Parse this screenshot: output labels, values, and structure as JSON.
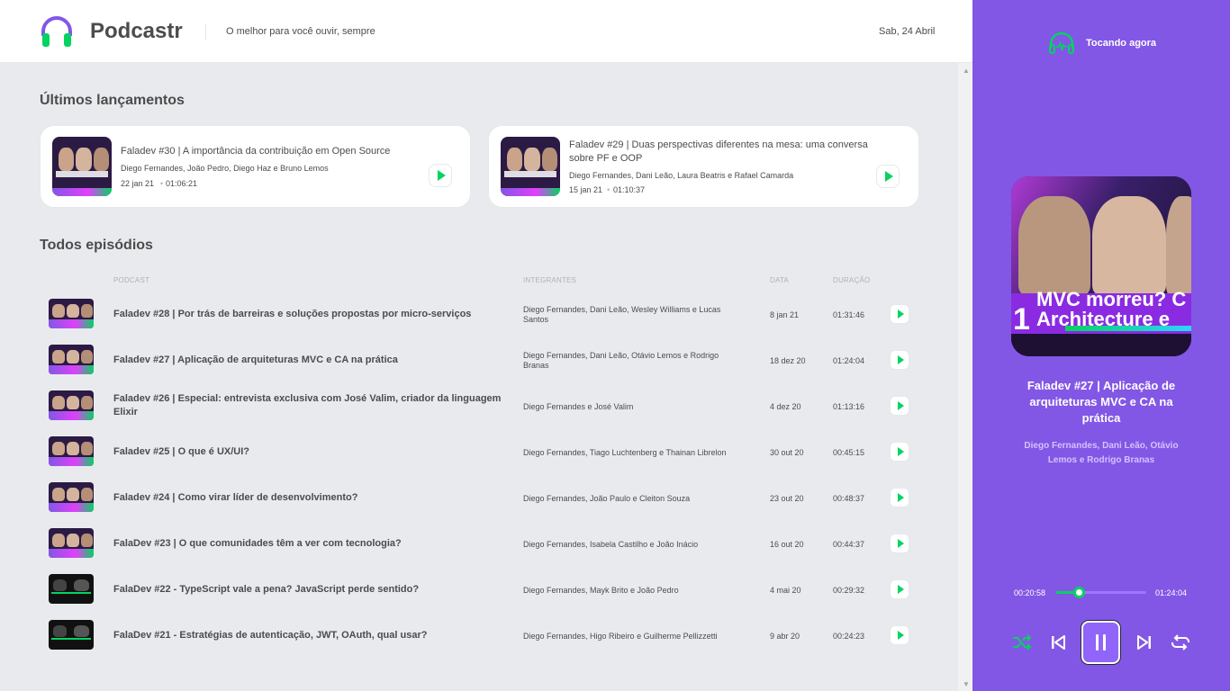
{
  "header": {
    "brand": "Podcastr",
    "tagline": "O melhor para você ouvir, sempre",
    "date": "Sab, 24 Abril"
  },
  "latest": {
    "title": "Últimos lançamentos",
    "episodes": [
      {
        "title": "Faladev #30 | A importância da contribuição em Open Source",
        "members": "Diego Fernandes, João Pedro, Diego Haz e Bruno Lemos",
        "date": "22 jan 21",
        "duration": "01:06:21"
      },
      {
        "title": "Faladev #29 | Duas perspectivas diferentes na mesa: uma conversa sobre PF e OOP",
        "members": "Diego Fernandes, Dani Leão, Laura Beatris e Rafael Camarda",
        "date": "15 jan 21",
        "duration": "01:10:37"
      }
    ]
  },
  "all": {
    "title": "Todos episódios",
    "columns": {
      "podcast": "PODCAST",
      "members": "INTEGRANTES",
      "date": "DATA",
      "duration": "DURAÇÃO"
    },
    "episodes": [
      {
        "title": "Faladev #28 | Por trás de barreiras e soluções propostas por micro-serviços",
        "members": "Diego Fernandes, Dani Leão, Wesley Williams e Lucas Santos",
        "date": "8 jan 21",
        "duration": "01:31:46"
      },
      {
        "title": "Faladev #27 | Aplicação de arquiteturas MVC e CA na prática",
        "members": "Diego Fernandes, Dani Leão, Otávio Lemos e Rodrigo Branas",
        "date": "18 dez 20",
        "duration": "01:24:04"
      },
      {
        "title": "Faladev #26 | Especial: entrevista exclusiva com José Valim, criador da linguagem Elixir",
        "members": "Diego Fernandes e José Valim",
        "date": "4 dez 20",
        "duration": "01:13:16"
      },
      {
        "title": "Faladev #25 | O que é UX/UI?",
        "members": "Diego Fernandes, Tiago Luchtenberg e Thainan Librelon",
        "date": "30 out 20",
        "duration": "00:45:15"
      },
      {
        "title": "Faladev #24 | Como virar líder de desenvolvimento?",
        "members": "Diego Fernandes, João Paulo e Cleiton Souza",
        "date": "23 out 20",
        "duration": "00:48:37"
      },
      {
        "title": "FalaDev #23 | O que comunidades têm a ver com tecnologia?",
        "members": "Diego Fernandes, Isabela Castilho e João Inácio",
        "date": "16 out 20",
        "duration": "00:44:37"
      },
      {
        "title": "FalaDev #22 - TypeScript vale a pena? JavaScript perde sentido?",
        "members": "Diego Fernandes, Mayk Brito e João Pedro",
        "date": "4 mai 20",
        "duration": "00:29:32"
      },
      {
        "title": "FalaDev #21 - Estratégias de autenticação, JWT, OAuth, qual usar?",
        "members": "Diego Fernandes, Higo Ribeiro e Guilherme Pellizzetti",
        "date": "9 abr 20",
        "duration": "00:24:23"
      }
    ]
  },
  "player": {
    "label": "Tocando agora",
    "cover_text_line1": "MVC morreu? C",
    "cover_text_line2": "Architecture e",
    "cover_number": "1",
    "title": "Faladev #27 | Aplicação de arquiteturas MVC e CA na prática",
    "members": "Diego Fernandes, Dani Leão, Otávio Lemos e Rodrigo Branas",
    "current_time": "00:20:58",
    "total_time": "01:24:04",
    "progress_fraction": 0.25,
    "controls": [
      "shuffle-icon",
      "previous-icon",
      "pause-icon",
      "next-icon",
      "repeat-icon"
    ]
  },
  "colors": {
    "purple": "#8257E5",
    "green": "#04D361",
    "text": "#494D4B",
    "background": "#E9EAEE"
  }
}
